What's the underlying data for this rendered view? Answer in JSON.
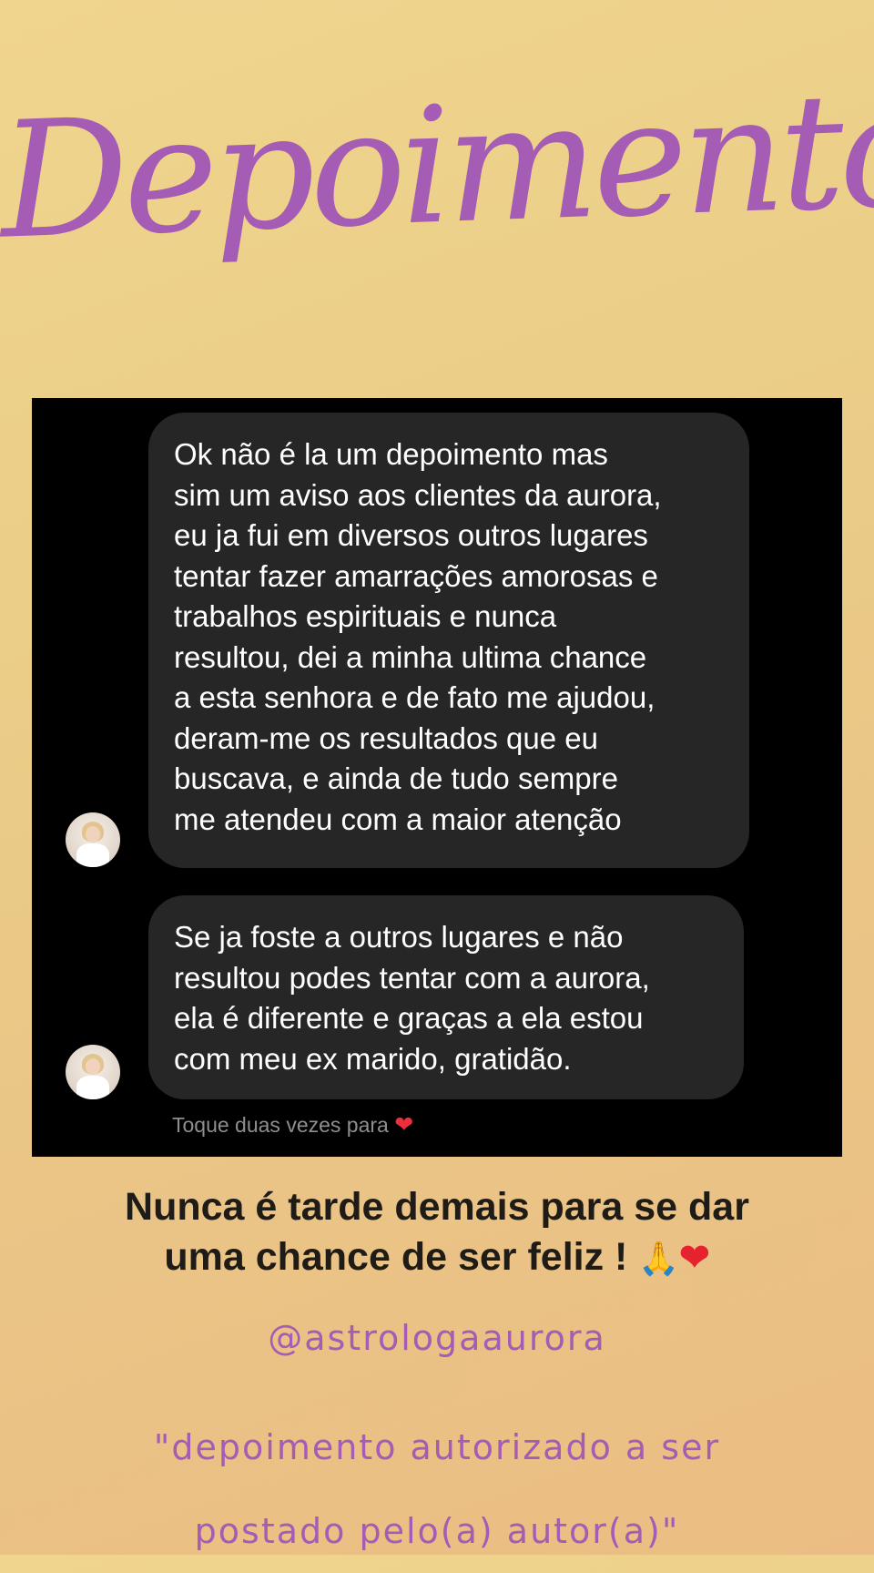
{
  "title": "Depoimentos",
  "chat": {
    "message_1": [
      "Ok não é la um depoimento mas",
      "sim um aviso aos clientes da aurora,",
      "eu ja fui em diversos outros lugares",
      "tentar fazer amarrações amorosas e",
      "trabalhos espirituais e nunca",
      "resultou, dei a minha ultima chance",
      "a esta senhora e de fato me ajudou,",
      "deram-me os resultados que eu",
      "buscava, e ainda de tudo sempre",
      "me atendeu com a maior atenção"
    ],
    "message_2": [
      "Se ja foste a outros lugares e não",
      "resultou podes tentar com a aurora,",
      "ela é diferente e graças a ela estou",
      "com meu ex marido, gratidão."
    ],
    "reaction_hint": "Toque duas vezes para",
    "reaction_icon": "heart-icon",
    "heart_glyph": "❤",
    "colors": {
      "panel_bg": "#000000",
      "bubble_bg": "#262626",
      "bubble_text": "#ffffff",
      "hint_text": "#8e8e8e",
      "heart": "#ed2f3d"
    }
  },
  "tagline": {
    "line_1": "Nunca é tarde demais para se dar",
    "line_2": "uma chance de ser feliz !",
    "pray_glyph": "🙏",
    "heart_glyph": "❤"
  },
  "handle": "@astrologaaurora",
  "disclaimer": {
    "line_1": "\"depoimento autorizado a ser",
    "line_2": "postado pelo(a) autor(a)\""
  },
  "colors": {
    "accent_purple": "#a45cb4",
    "background_top": "#f0d58f",
    "background_bottom": "#ebbd84"
  }
}
